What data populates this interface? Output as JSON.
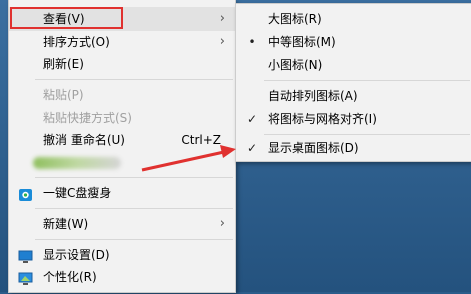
{
  "main_menu": {
    "view": "查看(V)",
    "sort_by": "排序方式(O)",
    "refresh": "刷新(E)",
    "paste": "粘贴(P)",
    "paste_shortcut": "粘贴快捷方式(S)",
    "undo_rename": "撤消 重命名(U)",
    "undo_shortcut": "Ctrl+Z",
    "one_key_clean": "一键C盘瘦身",
    "new": "新建(W)",
    "display_settings": "显示设置(D)",
    "personalize": "个性化(R)"
  },
  "view_submenu": {
    "large_icons": "大图标(R)",
    "medium_icons": "中等图标(M)",
    "small_icons": "小图标(N)",
    "auto_arrange": "自动排列图标(A)",
    "align_to_grid": "将图标与网格对齐(I)",
    "show_desktop_icons": "显示桌面图标(D)"
  },
  "marks": {
    "bullet": "•",
    "check": "✓",
    "chevron": "›"
  },
  "colors": {
    "highlight_box": "#e0312f",
    "annotation_arrow": "#e0312f"
  }
}
